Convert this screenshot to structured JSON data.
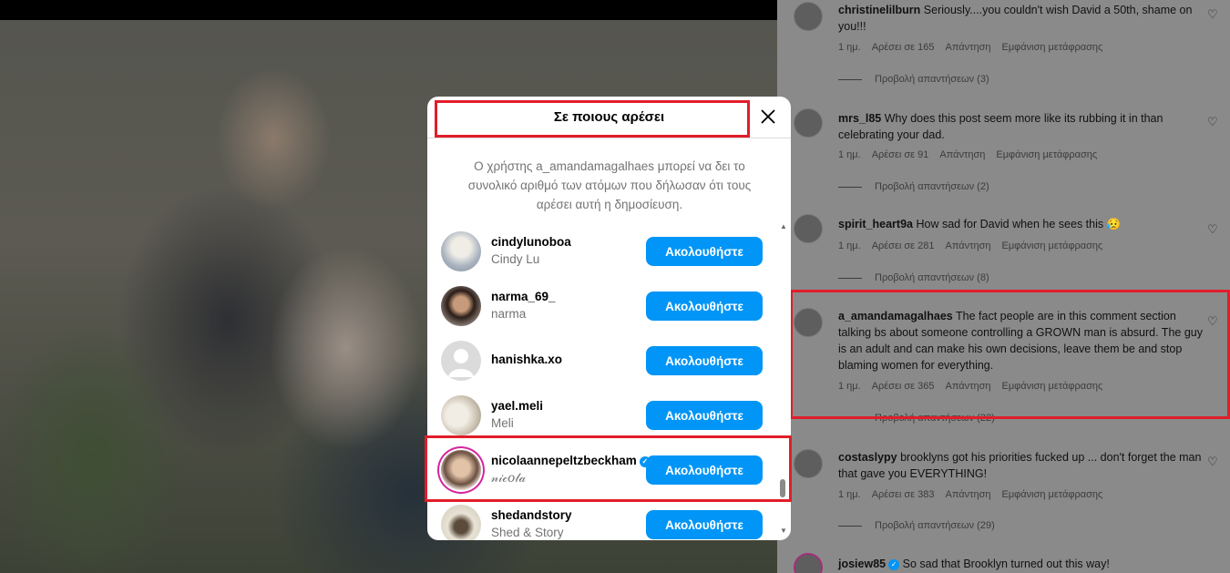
{
  "modal": {
    "title": "Σε ποιους αρέσει",
    "note": "Ο χρήστης a_amandamagalhaes μπορεί να δει το συνολικό αριθμό των ατόμων που δήλωσαν ότι τους αρέσει αυτή η δημοσίευση.",
    "follow_label": "Ακολουθήστε",
    "users": [
      {
        "username": "cindylunoboa",
        "name": "Cindy Lu",
        "avatar_color": "#c8cfd6",
        "verified": false
      },
      {
        "username": "narma_69_",
        "name": "narma",
        "avatar_color": "#3a2a24",
        "verified": false
      },
      {
        "username": "hanishka.xo",
        "name": "",
        "avatar_color": "#dbdbdb",
        "verified": false
      },
      {
        "username": "yael.meli",
        "name": "Meli",
        "avatar_color": "#d8d2c8",
        "verified": false
      },
      {
        "username": "nicolaannepeltzbeckham",
        "name": "𝓃𝒾𝒸𝑜𝓁𝒶",
        "avatar_color": "#c9a389",
        "verified": true
      },
      {
        "username": "shedandstory",
        "name": "Shed & Story",
        "avatar_color": "#e8e3d6",
        "verified": false
      }
    ]
  },
  "comments": [
    {
      "user": "christinelilburn",
      "text": "Seriously....you couldn't wish David a 50th, shame on you!!!",
      "time": "1 ημ.",
      "likes": "Αρέσει σε 165",
      "reply": "Απάντηση",
      "translate": "Εμφάνιση μετάφρασης",
      "replies": "Προβολή απαντήσεων (3)"
    },
    {
      "user": "mrs_l85",
      "text": "Why does this post seem more like its rubbing it in than celebrating your dad.",
      "time": "1 ημ.",
      "likes": "Αρέσει σε 91",
      "reply": "Απάντηση",
      "translate": "Εμφάνιση μετάφρασης",
      "replies": "Προβολή απαντήσεων (2)"
    },
    {
      "user": "spirit_heart9a",
      "text": "How sad for David when he sees this 😥",
      "time": "1 ημ.",
      "likes": "Αρέσει σε 281",
      "reply": "Απάντηση",
      "translate": "Εμφάνιση μετάφρασης",
      "replies": "Προβολή απαντήσεων (8)"
    },
    {
      "user": "a_amandamagalhaes",
      "text": "The fact people are in this comment section talking bs about someone controlling a GROWN man is absurd. The guy is an adult and can make his own decisions, leave them be and stop blaming women for everything.",
      "time": "1 ημ.",
      "likes": "Αρέσει σε 365",
      "reply": "Απάντηση",
      "translate": "Εμφάνιση μετάφρασης",
      "replies": "Προβολή απαντήσεων (22)"
    },
    {
      "user": "costaslypy",
      "text": "brooklyns got his priorities fucked up ... don't forget the man that gave you EVERYTHING!",
      "time": "1 ημ.",
      "likes": "Αρέσει σε 383",
      "reply": "Απάντηση",
      "translate": "Εμφάνιση μετάφρασης",
      "replies": "Προβολή απαντήσεων (29)"
    },
    {
      "user": "josiew85",
      "text": "So sad that Brooklyn turned out this way!",
      "verified": true
    }
  ],
  "colors": {
    "accent": "#0095f6",
    "highlight": "#e11d2a"
  },
  "icons": {
    "close": "close-icon",
    "heart": "heart-icon",
    "verified": "verified-badge-icon"
  }
}
